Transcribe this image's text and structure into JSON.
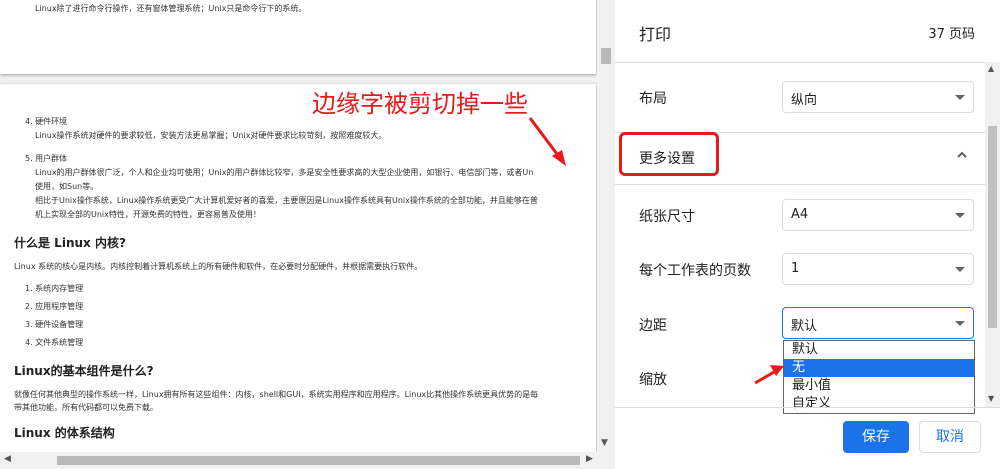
{
  "preview": {
    "page1_text": "Linux除了进行命令行操作，还有窗体管理系统；Unix只是命令行下的系统。",
    "item4_title": "4. 硬件环境",
    "item4_body": "Linux操作系统对硬件的要求较低，安装方法更易掌握；Unix对硬件要求比较苛刻，按照难度较大。",
    "item5_title": "5. 用户群体",
    "item5_body1": "Linux的用户群体很广泛，个人和企业均可使用；Unix的用户群体比较窄，多是安全性要求高的大型企业使用，如银行、电信部门等，或者Un",
    "item5_body2": "使用，如Sun等。",
    "item5_body3": "相比于Unix操作系统，Linux操作系统更受广大计算机爱好者的喜爱，主要原因是Linux操作系统具有Unix操作系统的全部功能，并且能够在普",
    "item5_body4": "机上实现全部的Unix特性，开源免费的特性，更容易普及使用！",
    "h_kernel": "什么是 Linux 内核?",
    "p_kernel": "Linux 系统的核心是内核。内核控制着计算机系统上的所有硬件和软件，在必要时分配硬件，并根据需要执行软件。",
    "kernel_list": [
      "1. 系统内存管理",
      "2. 应用程序管理",
      "3. 硬件设备管理",
      "4. 文件系统管理"
    ],
    "h_components": "Linux的基本组件是什么?",
    "p_components1": "就像任何其他典型的操作系统一样，Linux拥有所有这些组件：内核，shell和GUI，系统实用程序和应用程序。Linux比其他操作系统更具优势的是每",
    "p_components2": "带其他功能，所有代码都可以免费下载。",
    "h_arch": "Linux 的体系结构",
    "annotation": "边缘字被剪切掉一些"
  },
  "panel": {
    "title": "打印",
    "page_count": "37 页码",
    "layout_label": "布局",
    "layout_value": "纵向",
    "more_settings_label": "更多设置",
    "paper_size_label": "纸张尺寸",
    "paper_size_value": "A4",
    "pages_per_sheet_label": "每个工作表的页数",
    "pages_per_sheet_value": "1",
    "margins_label": "边距",
    "margins_value": "默认",
    "scale_label": "缩放",
    "margin_options": [
      "默认",
      "无",
      "最小值",
      "自定义"
    ],
    "selected_option": "无",
    "save_label": "保存",
    "cancel_label": "取消"
  },
  "colors": {
    "accent": "#1a73e8",
    "annotation_red": "#e8191a"
  },
  "icons": {
    "collapse": "chevron-up-icon",
    "dropdown": "caret-down-icon"
  }
}
